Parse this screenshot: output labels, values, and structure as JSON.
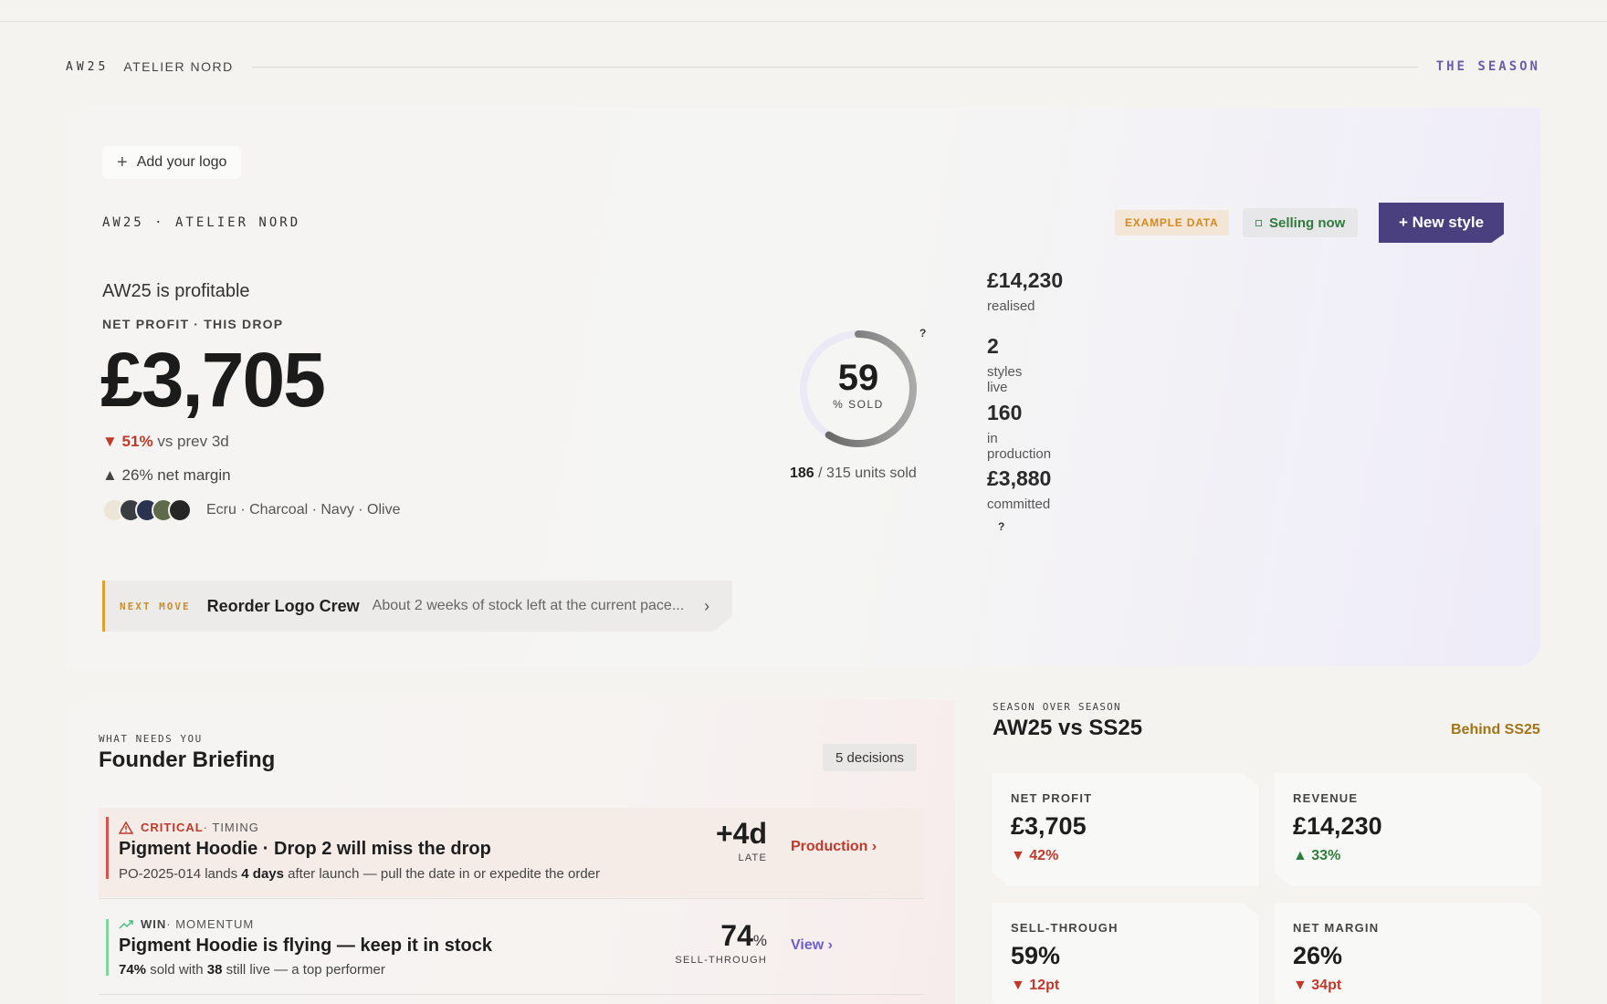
{
  "header": {
    "season": "AW25",
    "brand": "ATELIER NORD",
    "right_label": "THE SEASON"
  },
  "hero": {
    "logo_button": "Add your logo",
    "label": "AW25 · ATELIER NORD",
    "example_tag": "EXAMPLE DATA",
    "status": "Selling now",
    "new_style_button": "+ New style",
    "title": "AW25 is profitable",
    "subtitle": "NET PROFIT · THIS DROP",
    "net_profit": "£3,705",
    "delta_value": "▼ 51%",
    "delta_label": "vs prev 3d",
    "margin": "▲ 26% net margin",
    "swatch_colors": [
      "#ece6d6",
      "#3a3d42",
      "#2b3350",
      "#5e6b4b",
      "#262626"
    ],
    "swatch_names": "Ecru · Charcoal · Navy · Olive",
    "next_move": {
      "label": "NEXT MOVE",
      "title": "Reorder Logo Crew",
      "description": "About 2 weeks of stock left at the current pace...",
      "chevron": "›"
    },
    "sold_ring": {
      "value": "59",
      "percent": 59,
      "label": "% SOLD",
      "help": "?"
    },
    "units_sold": "186",
    "units_total": "/ 315 units sold",
    "stats": [
      {
        "value": "£14,230",
        "label": "realised"
      },
      {
        "value": "2",
        "label": "styles live"
      },
      {
        "value": "160",
        "label": "in production"
      },
      {
        "value": "£3,880",
        "label": "committed"
      }
    ],
    "stats_help": "?"
  },
  "briefing": {
    "kicker": "WHAT NEEDS YOU",
    "title": "Founder Briefing",
    "count": "5 decisions",
    "rows": [
      {
        "severity": "CRITICAL",
        "category": "· TIMING",
        "title": "Pigment Hoodie · Drop 2 will miss the drop",
        "desc_pre": "PO-2025-014 lands ",
        "desc_bold": "4 days",
        "desc_post": " after launch — pull the date in or expedite the order",
        "metric": "+4d",
        "metric_caption": "LATE",
        "link": "Production ›"
      },
      {
        "severity": "WIN",
        "category": "· MOMENTUM",
        "title": "Pigment Hoodie is flying — keep it in stock",
        "desc_bold1": "74%",
        "desc_mid": " sold with ",
        "desc_bold2": "38",
        "desc_post": " still live — a top performer",
        "metric": "74",
        "metric_unit": "%",
        "metric_caption": "SELL-THROUGH",
        "link": "View ›"
      }
    ]
  },
  "season_over_season": {
    "kicker": "SEASON OVER SEASON",
    "title": "AW25 vs SS25",
    "status": "Behind SS25",
    "kpis": [
      {
        "label": "NET PROFIT",
        "value": "£3,705",
        "delta": "▼ 42%",
        "direction": "down"
      },
      {
        "label": "REVENUE",
        "value": "£14,230",
        "delta": "▲ 33%",
        "direction": "up"
      },
      {
        "label": "SELL-THROUGH",
        "value": "59%",
        "delta": "▼ 12pt",
        "direction": "down"
      },
      {
        "label": "NET MARGIN",
        "value": "26%",
        "delta": "▼ 34pt",
        "direction": "down"
      }
    ]
  },
  "colors": {
    "accent": "#4a4080",
    "critical": "#c0392b",
    "win": "#3fbf7f",
    "warning": "#e0a030"
  }
}
